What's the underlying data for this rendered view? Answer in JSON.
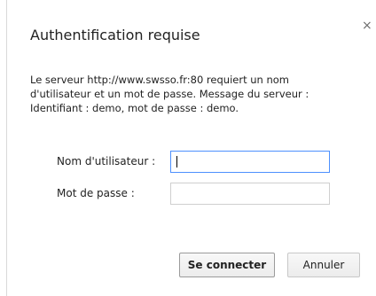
{
  "dialog": {
    "title": "Authentification requise",
    "close_symbol": "×",
    "message_lines": [
      "Le serveur http://www.swsso.fr:80 requiert un nom",
      "d'utilisateur et un mot de passe. Message du serveur :",
      "Identifiant : demo, mot de passe : demo."
    ]
  },
  "form": {
    "username_label": "Nom d'utilisateur :",
    "username_value": "",
    "password_label": "Mot de passe :",
    "password_value": ""
  },
  "buttons": {
    "connect_label": "Se connecter",
    "cancel_label": "Annuler"
  },
  "colors": {
    "focus_border": "#4d90fe",
    "field_border": "#cfcfcf",
    "text": "#222222"
  },
  "icons": {
    "close": "close-icon"
  }
}
